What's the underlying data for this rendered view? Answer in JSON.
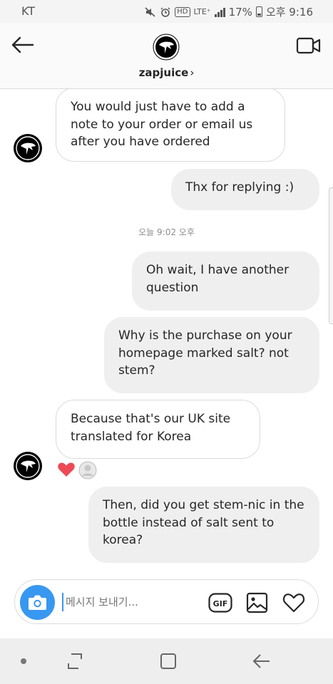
{
  "status_bar": {
    "carrier": "KT",
    "hd_badge": "HD",
    "network": "LTE⁺",
    "battery": "17%",
    "time": "오후 9:16"
  },
  "header": {
    "username": "zapjuice",
    "chevron": "›"
  },
  "messages": [
    {
      "side": "received",
      "text": "You would just have to add a note to your order or email us after you have ordered"
    },
    {
      "side": "sent",
      "text": "Thx for replying :)"
    },
    {
      "side": "sent",
      "text": "Oh wait, I have another question"
    },
    {
      "side": "sent",
      "text": "Why is the purchase on your homepage marked salt? not stem?"
    },
    {
      "side": "received",
      "text": "Because that's our UK site translated for Korea"
    },
    {
      "side": "sent",
      "text": "Then, did you get stem-nic in the bottle instead of salt sent to korea?"
    }
  ],
  "timestamp": "오늘 9:02 오후",
  "composer": {
    "placeholder": "메시지 보내기...",
    "gif_label": "GIF"
  },
  "colors": {
    "accent": "#3897f0",
    "like": "#ed4956",
    "received_bubble": "#ffffff",
    "sent_bubble": "#efefef"
  },
  "icons": [
    "back-arrow-icon",
    "video-call-icon",
    "camera-icon",
    "gif-icon",
    "gallery-icon",
    "heart-icon",
    "like-reaction-icon"
  ]
}
